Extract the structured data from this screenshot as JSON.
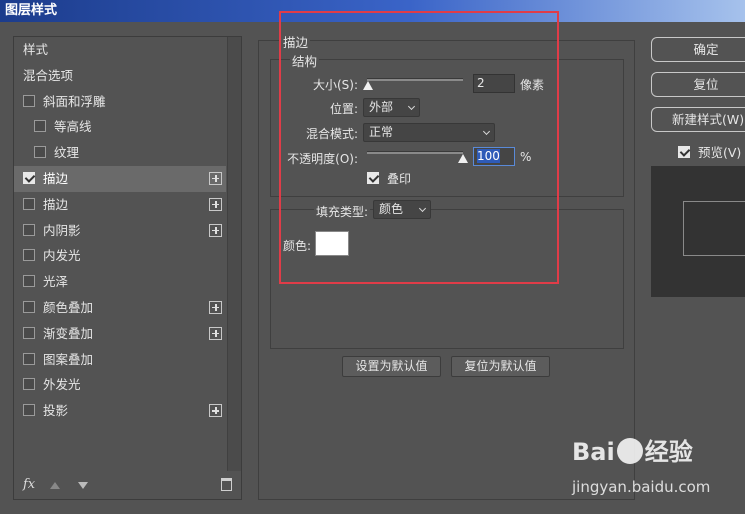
{
  "window": {
    "title": "图层样式"
  },
  "style_list": {
    "items": [
      {
        "label": "样式",
        "checkbox": false,
        "checked": false,
        "plus": false,
        "indent": false,
        "selected": false
      },
      {
        "label": "混合选项",
        "checkbox": false,
        "checked": false,
        "plus": false,
        "indent": false,
        "selected": false
      },
      {
        "label": "斜面和浮雕",
        "checkbox": true,
        "checked": false,
        "plus": false,
        "indent": false,
        "selected": false
      },
      {
        "label": "等高线",
        "checkbox": true,
        "checked": false,
        "plus": false,
        "indent": true,
        "selected": false
      },
      {
        "label": "纹理",
        "checkbox": true,
        "checked": false,
        "plus": false,
        "indent": true,
        "selected": false
      },
      {
        "label": "描边",
        "checkbox": true,
        "checked": true,
        "plus": true,
        "indent": false,
        "selected": true
      },
      {
        "label": "描边",
        "checkbox": true,
        "checked": false,
        "plus": true,
        "indent": false,
        "selected": false
      },
      {
        "label": "内阴影",
        "checkbox": true,
        "checked": false,
        "plus": true,
        "indent": false,
        "selected": false
      },
      {
        "label": "内发光",
        "checkbox": true,
        "checked": false,
        "plus": false,
        "indent": false,
        "selected": false
      },
      {
        "label": "光泽",
        "checkbox": true,
        "checked": false,
        "plus": false,
        "indent": false,
        "selected": false
      },
      {
        "label": "颜色叠加",
        "checkbox": true,
        "checked": false,
        "plus": true,
        "indent": false,
        "selected": false
      },
      {
        "label": "渐变叠加",
        "checkbox": true,
        "checked": false,
        "plus": true,
        "indent": false,
        "selected": false
      },
      {
        "label": "图案叠加",
        "checkbox": true,
        "checked": false,
        "plus": false,
        "indent": false,
        "selected": false
      },
      {
        "label": "外发光",
        "checkbox": true,
        "checked": false,
        "plus": false,
        "indent": false,
        "selected": false
      },
      {
        "label": "投影",
        "checkbox": true,
        "checked": false,
        "plus": true,
        "indent": false,
        "selected": false
      }
    ],
    "footer": {
      "fx_label": "fx"
    }
  },
  "stroke": {
    "section_title": "描边",
    "structure_title": "结构",
    "size_label": "大小(S):",
    "size_value": "2",
    "size_unit": "像素",
    "size_level": 0.01,
    "position_label": "位置:",
    "position_value": "外部",
    "blend_label": "混合模式:",
    "blend_value": "正常",
    "opacity_label": "不透明度(O):",
    "opacity_value": "100",
    "opacity_unit": "%",
    "opacity_level": 1.0,
    "overprint_label": "叠印",
    "overprint_checked": true,
    "fill_type_label": "填充类型:",
    "fill_type_value": "颜色",
    "color_label": "颜色:",
    "color_value": "#ffffff",
    "set_default_button": "设置为默认值",
    "reset_default_button": "复位为默认值"
  },
  "right": {
    "ok_button": "确定",
    "reset_button": "复位",
    "new_style_button": "新建样式(W)...",
    "preview_label": "预览(V)",
    "preview_checked": true
  },
  "watermark": {
    "brand": "Bai",
    "brand_cn": "经验",
    "url": "jingyan.baidu.com"
  },
  "colors": {
    "highlight": "#e03c48",
    "selection": "#2e5bb8",
    "panel_bg": "#535353"
  }
}
